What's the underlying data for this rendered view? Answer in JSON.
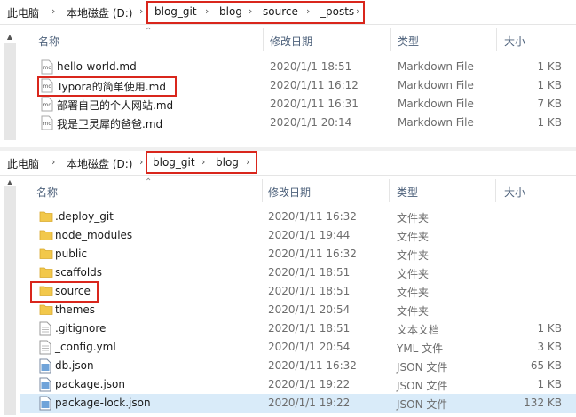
{
  "top_pane": {
    "breadcrumb": [
      "此电脑",
      "本地磁盘 (D:)",
      "blog_git",
      "blog",
      "source",
      "_posts"
    ],
    "columns": {
      "name": "名称",
      "date": "修改日期",
      "type": "类型",
      "size": "大小"
    },
    "files": [
      {
        "name": "hello-world.md",
        "date": "2020/1/1 18:51",
        "type": "Markdown File",
        "size": "1 KB",
        "icon": "markdown-file-icon"
      },
      {
        "name": "Typora的简单使用.md",
        "date": "2020/1/11 16:12",
        "type": "Markdown File",
        "size": "1 KB",
        "icon": "markdown-file-icon"
      },
      {
        "name": "部署自己的个人网站.md",
        "date": "2020/1/11 16:31",
        "type": "Markdown File",
        "size": "7 KB",
        "icon": "markdown-file-icon"
      },
      {
        "name": "我是卫灵犀的爸爸.md",
        "date": "2020/1/1 20:14",
        "type": "Markdown File",
        "size": "1 KB",
        "icon": "markdown-file-icon"
      }
    ]
  },
  "bottom_pane": {
    "breadcrumb": [
      "此电脑",
      "本地磁盘 (D:)",
      "blog_git",
      "blog"
    ],
    "columns": {
      "name": "名称",
      "date": "修改日期",
      "type": "类型",
      "size": "大小"
    },
    "files": [
      {
        "name": ".deploy_git",
        "date": "2020/1/11 16:32",
        "type": "文件夹",
        "size": "",
        "icon": "folder-icon"
      },
      {
        "name": "node_modules",
        "date": "2020/1/1 19:44",
        "type": "文件夹",
        "size": "",
        "icon": "folder-icon"
      },
      {
        "name": "public",
        "date": "2020/1/11 16:32",
        "type": "文件夹",
        "size": "",
        "icon": "folder-icon"
      },
      {
        "name": "scaffolds",
        "date": "2020/1/1 18:51",
        "type": "文件夹",
        "size": "",
        "icon": "folder-icon"
      },
      {
        "name": "source",
        "date": "2020/1/1 18:51",
        "type": "文件夹",
        "size": "",
        "icon": "folder-icon"
      },
      {
        "name": "themes",
        "date": "2020/1/1 20:54",
        "type": "文件夹",
        "size": "",
        "icon": "folder-icon"
      },
      {
        "name": ".gitignore",
        "date": "2020/1/1 18:51",
        "type": "文本文档",
        "size": "1 KB",
        "icon": "text-file-icon"
      },
      {
        "name": "_config.yml",
        "date": "2020/1/1 20:54",
        "type": "YML 文件",
        "size": "3 KB",
        "icon": "text-file-icon"
      },
      {
        "name": "db.json",
        "date": "2020/1/11 16:32",
        "type": "JSON 文件",
        "size": "65 KB",
        "icon": "json-file-icon"
      },
      {
        "name": "package.json",
        "date": "2020/1/1 19:22",
        "type": "JSON 文件",
        "size": "1 KB",
        "icon": "json-file-icon"
      },
      {
        "name": "package-lock.json",
        "date": "2020/1/1 19:22",
        "type": "JSON 文件",
        "size": "132 KB",
        "icon": "json-file-icon"
      }
    ]
  },
  "colors": {
    "highlight_box": "#d9261c",
    "selected_row": "#d9ebf9",
    "folder": "#f2c84b",
    "header_text": "#4c607a"
  }
}
